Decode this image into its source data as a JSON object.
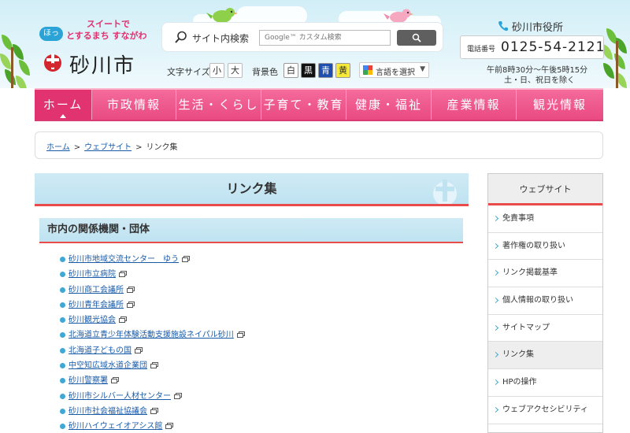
{
  "header": {
    "tagline_line1": "スイートで",
    "hotto_badge": "ほっ",
    "tagline_line2": "とするまち すながわ",
    "city_name": "砂川市",
    "search_label": "サイト内検索",
    "search_placeholder": "Google™ カスタム検索",
    "font_size_label": "文字サイズ",
    "font_small": "小",
    "font_large": "大",
    "bg_color_label": "背景色",
    "bg_white": "白",
    "bg_black": "黒",
    "bg_blue": "青",
    "bg_yellow": "黄",
    "language_select": "言語を選択",
    "office_name": "砂川市役所",
    "tel_label": "電話番号",
    "tel_number": "0125-54-2121",
    "hours_line1": "午前8時30分～午後5時15分",
    "hours_line2": "土・日、祝日を除く"
  },
  "nav": {
    "items": [
      "ホーム",
      "市政情報",
      "生活・くらし",
      "子育て・教育",
      "健康・福祉",
      "産業情報",
      "観光情報"
    ]
  },
  "breadcrumb": {
    "home": "ホーム",
    "website": "ウェブサイト",
    "current": "リンク集",
    "sep": ">"
  },
  "main": {
    "title": "リンク集",
    "section_title": "市内の関係機関・団体",
    "links": [
      "砂川市地域交流センター　ゆう",
      "砂川市立病院",
      "砂川商工会議所",
      "砂川青年会議所",
      "砂川観光協会",
      "北海道立青少年体験活動支援施設ネイパル砂川",
      "北海道子どもの国",
      "中空知広域水道企業団",
      "砂川警察署",
      "砂川市シルバー人材センター",
      "砂川市社会福祉協議会",
      "砂川ハイウェイオアシス館"
    ]
  },
  "sidebar": {
    "heading": "ウェブサイト",
    "items": [
      "免責事項",
      "著作権の取り扱い",
      "リンク掲載基準",
      "個人情報の取り扱い",
      "サイトマップ",
      "リンク集",
      "HPの操作",
      "ウェブアクセシビリティ"
    ],
    "current_index": 5
  },
  "colors": {
    "nav_pink": "#e94a81",
    "accent_red": "#e94a4a",
    "sky_blue": "#cfeaf5",
    "link_blue": "#1a5ba8",
    "bullet_blue": "#3fa8d4"
  }
}
